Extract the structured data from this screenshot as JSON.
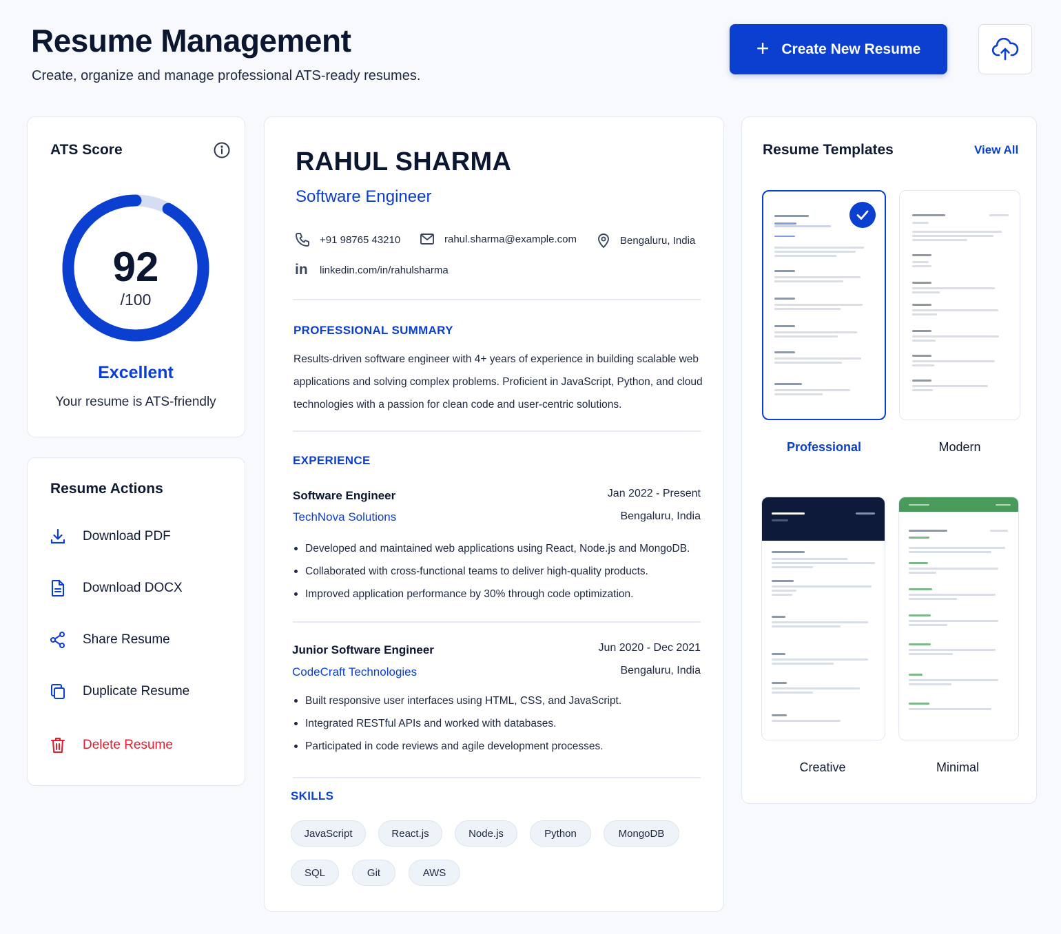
{
  "header": {
    "title": "Resume Management",
    "subtitle": "Create, organize and manage professional ATS-ready resumes.",
    "create_button": "Create New Resume",
    "upload_icon": "cloud-upload-icon"
  },
  "ats": {
    "title": "ATS Score",
    "score": "92",
    "max": "/100",
    "score_fraction": 0.92,
    "rating": "Excellent",
    "note": "Your resume is ATS-friendly"
  },
  "actions": {
    "title": "Resume Actions",
    "items": [
      {
        "label": "Download PDF",
        "icon": "download-icon"
      },
      {
        "label": "Download DOCX",
        "icon": "document-icon"
      },
      {
        "label": "Share Resume",
        "icon": "share-icon"
      },
      {
        "label": "Duplicate Resume",
        "icon": "copy-icon"
      },
      {
        "label": "Delete Resume",
        "icon": "trash-icon"
      }
    ]
  },
  "resume": {
    "name": "RAHUL SHARMA",
    "role": "Software Engineer",
    "phone": "+91 98765 43210",
    "email": "rahul.sharma@example.com",
    "location": "Bengaluru, India",
    "linkedin": "linkedin.com/in/rahulsharma",
    "summary_heading": "PROFESSIONAL SUMMARY",
    "summary": "Results-driven software engineer with 4+ years of experience in building scalable web applications and solving complex problems. Proficient in JavaScript, Python, and cloud technologies with a passion for clean code and user-centric solutions.",
    "experience_heading": "EXPERIENCE",
    "jobs": [
      {
        "title": "Software Engineer",
        "company": "TechNova Solutions",
        "dates": "Jan 2022 - Present",
        "location": "Bengaluru, India",
        "bullets": [
          "Developed and maintained web applications using React, Node.js and MongoDB.",
          "Collaborated with cross-functional teams to deliver high-quality products.",
          "Improved application performance by 30% through code optimization."
        ]
      },
      {
        "title": "Junior Software Engineer",
        "company": "CodeCraft Technologies",
        "dates": "Jun 2020 - Dec 2021",
        "location": "Bengaluru, India",
        "bullets": [
          "Built responsive user interfaces using HTML, CSS, and JavaScript.",
          "Integrated RESTful APIs and worked with databases.",
          "Participated in code reviews and agile development processes."
        ]
      }
    ],
    "skills_heading": "SKILLS",
    "skills": [
      "JavaScript",
      "React.js",
      "Node.js",
      "Python",
      "MongoDB",
      "SQL",
      "Git",
      "AWS"
    ]
  },
  "templates": {
    "title": "Resume Templates",
    "view_all": "View All",
    "items": [
      {
        "label": "Professional",
        "selected": true
      },
      {
        "label": "Modern",
        "selected": false
      },
      {
        "label": "Creative",
        "selected": false
      },
      {
        "label": "Minimal",
        "selected": false
      }
    ]
  },
  "colors": {
    "accent": "#0b3fcf",
    "danger": "#e11d2e",
    "creative_header": "#0d1a3a",
    "minimal_header": "#4a9a5c"
  }
}
